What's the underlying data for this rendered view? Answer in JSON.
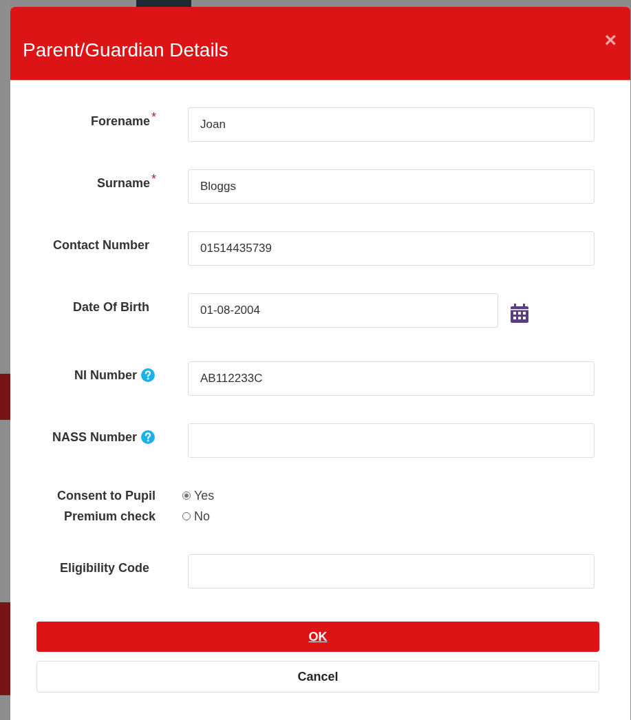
{
  "dialog": {
    "title": "Parent/Guardian Details",
    "close": "×"
  },
  "fields": [
    {
      "kind": "text",
      "label": "Forename",
      "required_mark": "*",
      "value": "Joan"
    },
    {
      "kind": "text",
      "label": "Surname",
      "required_mark": "*",
      "value": "Bloggs"
    },
    {
      "kind": "text",
      "label": "Contact Number",
      "value": "01514435739"
    },
    {
      "kind": "date",
      "label": "Date Of Birth",
      "value": "01-08-2004"
    },
    {
      "kind": "text",
      "label": "NI Number",
      "help": true,
      "value": "AB112233C"
    },
    {
      "kind": "text",
      "label": "NASS Number",
      "help": true
    },
    {
      "kind": "radio",
      "label": "Consent to Pupil Premium check",
      "options": [
        {
          "label": "Yes",
          "selected": true
        },
        {
          "label": "No",
          "selected": false
        }
      ]
    },
    {
      "kind": "text",
      "label": "Eligibility Code"
    }
  ],
  "buttons": [
    {
      "kind": "primary",
      "label": "OK"
    },
    {
      "kind": "secondary",
      "label": "Cancel"
    }
  ]
}
